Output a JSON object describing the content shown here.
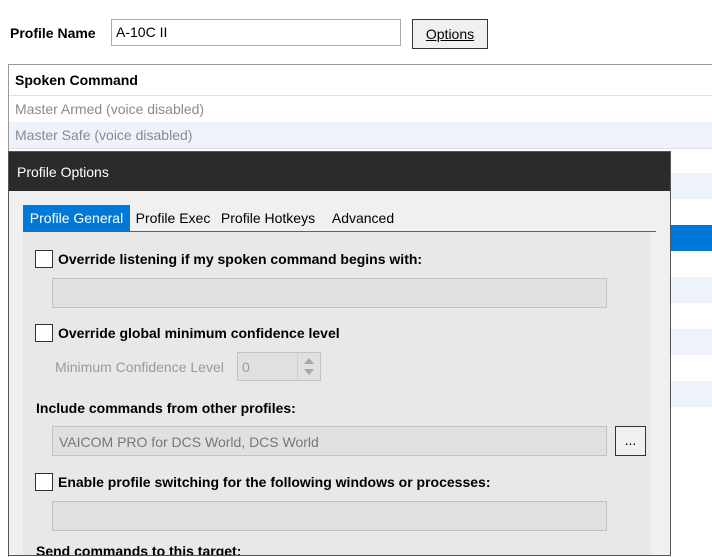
{
  "profile": {
    "label": "Profile Name",
    "name_value": "A-10C II",
    "options_label": "Options"
  },
  "commands_grid": {
    "header": "Spoken Command",
    "rows": [
      "Master Armed  (voice disabled)",
      "Master Safe  (voice disabled)"
    ]
  },
  "dialog": {
    "title": "Profile Options",
    "tabs": [
      "Profile General",
      "Profile Exec",
      "Profile Hotkeys",
      "Advanced"
    ],
    "active_tab": "Profile General",
    "override_listening": {
      "label": "Override listening if my spoken command begins with:",
      "checked": false,
      "value": ""
    },
    "override_confidence": {
      "label": "Override global minimum confidence level",
      "checked": false,
      "min_label": "Minimum Confidence Level",
      "min_value": "0"
    },
    "include_commands": {
      "label": "Include commands from other profiles:",
      "value": "VAICOM PRO for DCS World, DCS World",
      "browse_label": "..."
    },
    "profile_switching": {
      "label": "Enable profile switching for the following windows or processes:",
      "checked": false,
      "value": ""
    },
    "send_commands": {
      "label": "Send commands to this target:"
    }
  },
  "colors": {
    "accent": "#0078d7",
    "titlebar": "#2b2b2b",
    "row_alt": "#eef2fb",
    "dialog_bg": "#f0f0f0"
  }
}
